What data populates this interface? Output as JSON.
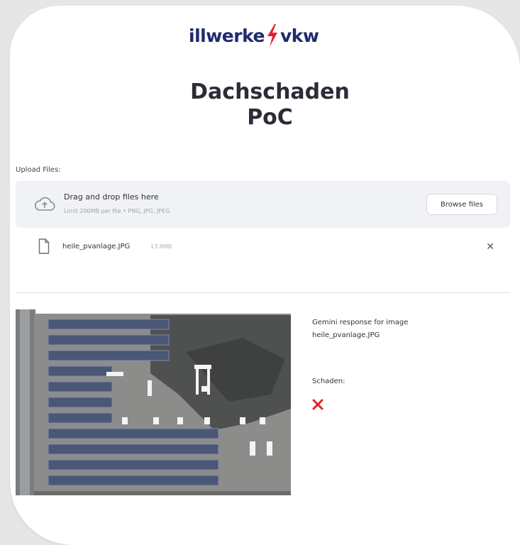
{
  "brand": {
    "left": "illwerke",
    "right": "vkw",
    "primary_color": "#1f2a6e",
    "bolt_color": "#e4202e"
  },
  "page": {
    "title_line1": "Dachschaden",
    "title_line2": "PoC"
  },
  "uploader": {
    "label": "Upload Files:",
    "drop_text": "Drag and drop files here",
    "limit_text": "Limit 200MB per file • PNG, JPG, JPEG",
    "browse_label": "Browse files",
    "icon": "cloud-upload-icon"
  },
  "uploaded_file": {
    "name": "heile_pvanlage.JPG",
    "size": "13.8MB",
    "icon": "file-icon",
    "remove_icon": "close-icon"
  },
  "result": {
    "response_text": "Gemini response for image heile_pvanlage.JPG",
    "damage_label": "Schaden:",
    "damage_icon": "red-cross-icon",
    "damage_color": "#e02424"
  }
}
